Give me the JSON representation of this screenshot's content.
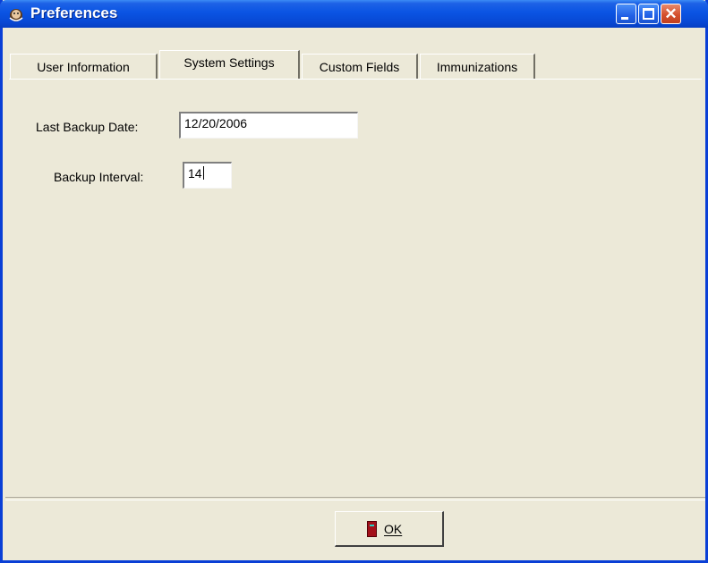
{
  "window": {
    "title": "Preferences"
  },
  "tabs": [
    {
      "label": "User Information",
      "active": false
    },
    {
      "label": "System Settings",
      "active": true
    },
    {
      "label": "Custom Fields",
      "active": false
    },
    {
      "label": "Immunizations",
      "active": false
    }
  ],
  "system_settings": {
    "last_backup_date_label": "Last Backup Date:",
    "last_backup_date_value": "12/20/2006",
    "backup_interval_label": "Backup Interval:",
    "backup_interval_value": "14"
  },
  "footer": {
    "ok_label": "OK"
  },
  "colors": {
    "titlebar": "#0a54e3",
    "face": "#ece9d8",
    "close_button": "#d4502e"
  }
}
